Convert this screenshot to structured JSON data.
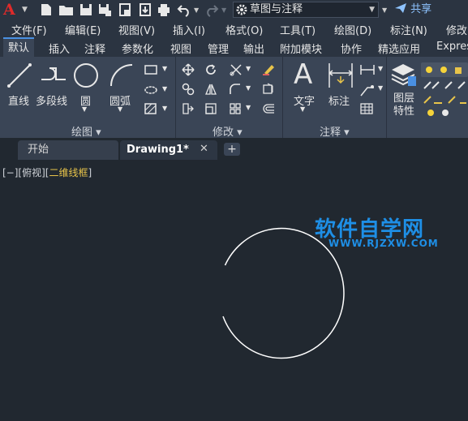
{
  "app": {
    "logo_letter": "A"
  },
  "quick_access": {
    "workspace": "草图与注释",
    "share": "共享"
  },
  "menu": [
    "文件(F)",
    "编辑(E)",
    "视图(V)",
    "插入(I)",
    "格式(O)",
    "工具(T)",
    "绘图(D)",
    "标注(N)",
    "修改"
  ],
  "ribbon_tabs": [
    "默认",
    "插入",
    "注释",
    "参数化",
    "视图",
    "管理",
    "输出",
    "附加模块",
    "协作",
    "精选应用",
    "Express"
  ],
  "ribbon": {
    "draw_tools": [
      "直线",
      "多段线",
      "圆",
      "圆弧"
    ],
    "text_tools": [
      "文字",
      "标注"
    ],
    "layer_tool": "图层特性",
    "panels": [
      "绘图",
      "修改",
      "注释"
    ]
  },
  "doc_tabs": {
    "start": "开始",
    "drawing": "Drawing1*"
  },
  "viewport": {
    "prefix": "[−][俯视][",
    "mode": "二维线框",
    "suffix": "]"
  },
  "watermark": {
    "title": "软件自学网",
    "url": "WWW.RJZXW.COM"
  }
}
